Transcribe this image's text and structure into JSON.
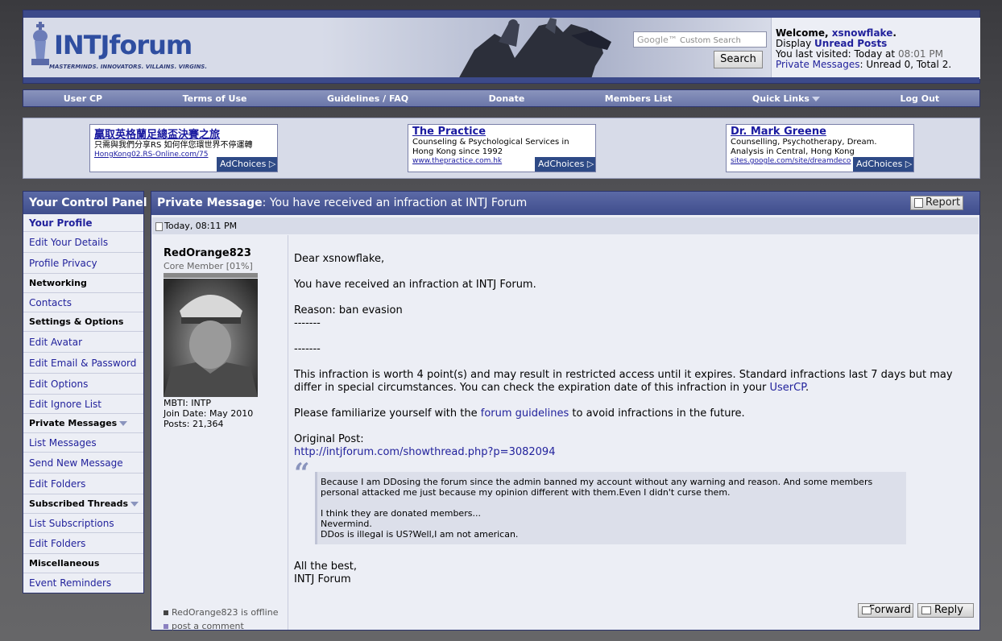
{
  "header": {
    "logo_text": "INTJforum",
    "logo_tagline": "MASTERMINDS. INNOVATORS. VILLAINS. VIRGINS.",
    "search_placeholder": "Custom Search",
    "search_brand": "Google™",
    "search_button": "Search",
    "welcome": {
      "prefix": "Welcome, ",
      "username": "xsnowflake",
      "suffix": ".",
      "display_prefix": "Display ",
      "unread_link": "Unread Posts",
      "last_visited_prefix": "You last visited: Today at ",
      "last_visited_time": "08:01 PM",
      "pm_link": "Private Messages",
      "pm_status": ": Unread 0, Total 2."
    }
  },
  "navbar": [
    "User CP",
    "Terms of Use",
    "Guidelines / FAQ",
    "Donate",
    "Members List",
    "Quick Links",
    "Log Out"
  ],
  "ads": [
    {
      "title": "贏取英格蘭足總盃決賽之旅",
      "desc": "只需與我們分享RS 如何伴您環世界不停運轉",
      "url": "HongKong02.RS-Online.com/75",
      "choices": "AdChoices"
    },
    {
      "title": "The Practice",
      "desc": "Counseling & Psychological Services in Hong Kong since 1992",
      "url": "www.thepractice.com.hk",
      "choices": "AdChoices"
    },
    {
      "title": "Dr. Mark Greene",
      "desc": "Counselling, Psychotherapy, Dream. Analysis in Central, Hong Kong",
      "url": "sites.google.com/site/dreamdeco",
      "choices": "AdChoices"
    }
  ],
  "sidebar": {
    "title": "Your Control Panel",
    "your_profile": "Your Profile",
    "edit_details": "Edit Your Details",
    "profile_privacy": "Profile Privacy",
    "networking": "Networking",
    "contacts": "Contacts",
    "settings_options": "Settings & Options",
    "edit_avatar": "Edit Avatar",
    "edit_email_password": "Edit Email & Password",
    "edit_options": "Edit Options",
    "edit_ignore_list": "Edit Ignore List",
    "private_messages": "Private Messages",
    "list_messages": "List Messages",
    "send_new_message": "Send New Message",
    "edit_folders_pm": "Edit Folders",
    "subscribed_threads": "Subscribed Threads",
    "list_subscriptions": "List Subscriptions",
    "edit_folders_sub": "Edit Folders",
    "miscellaneous": "Miscellaneous",
    "event_reminders": "Event Reminders"
  },
  "message": {
    "header_label": "Private Message",
    "header_title": ": You have received an infraction at INTJ Forum",
    "report_button": "Report",
    "date": "Today, 08:11 PM",
    "author": {
      "name": "RedOrange823",
      "rank": "Core Member [01%]",
      "mbti": "MBTI: INTP",
      "join_date": "Join Date: May 2010",
      "posts": "Posts: 21,364",
      "status": "RedOrange823 is offline",
      "post_comment": "post a comment"
    },
    "greeting": "Dear xsnowflake,",
    "line1": "You have received an infraction at INTJ Forum.",
    "reason": "Reason: ban evasion",
    "sep1": "-------",
    "sep2": "-------",
    "infraction_text": "This infraction is worth 4 point(s) and may result in restricted access until it expires. Standard infractions last 7 days but may differ in special circumstances. You can check the expiration date of this infraction in your ",
    "usercp_link": "UserCP",
    "infraction_end": ".",
    "familiarize_prefix": "Please familiarize yourself with the ",
    "guidelines_link": "forum guidelines",
    "familiarize_suffix": " to avoid infractions in the future.",
    "original_post_label": "Original Post:",
    "original_post_url": "http://intjforum.com/showthread.php?p=3082094",
    "quote_line1": "Because I am DDosing the forum since the admin banned my account without any warning and reason. And some members personal attacked me just because my opinion different with them.Even I didn't curse them.",
    "quote_line2": "I think they are donated members...",
    "quote_line3": "Nevermind.",
    "quote_line4": "DDos is illegal is US?Well,I am not american.",
    "signoff1": "All the best,",
    "signoff2": "INTJ Forum",
    "forward_button": "Forward",
    "reply_button": "Reply"
  }
}
